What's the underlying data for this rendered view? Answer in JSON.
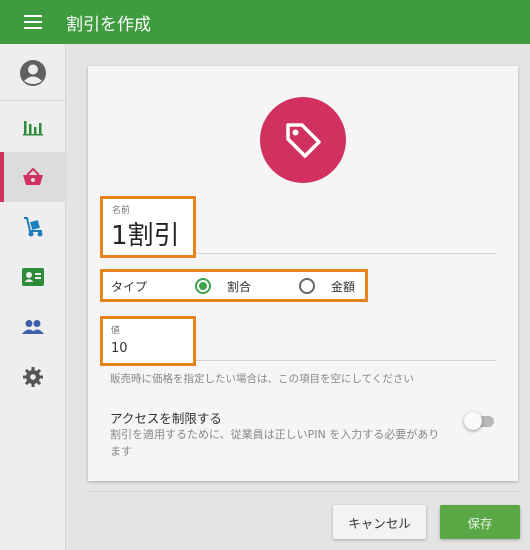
{
  "appbar": {
    "title": "割引を作成",
    "menu_icon": "hamburger-menu-icon"
  },
  "sidebar": {
    "items": [
      {
        "name": "account",
        "icon": "account-circle-icon",
        "color": "#616161"
      },
      {
        "name": "reports",
        "icon": "bar-chart-icon",
        "color": "#2e8b3a"
      },
      {
        "name": "discounts",
        "icon": "basket-icon",
        "color": "#d0315f",
        "active": true
      },
      {
        "name": "delivery",
        "icon": "hand-truck-icon",
        "color": "#1e7fc0"
      },
      {
        "name": "customers",
        "icon": "id-card-icon",
        "color": "#2e8b3a"
      },
      {
        "name": "employees",
        "icon": "people-icon",
        "color": "#3b5fa8"
      },
      {
        "name": "settings",
        "icon": "gear-icon",
        "color": "#555555"
      }
    ]
  },
  "form": {
    "tag_icon": "tag-icon",
    "tag_color": "#d0315f",
    "name_caption": "名前",
    "name_value": "1割引",
    "type_label": "タイプ",
    "type_options": [
      {
        "label": "割合",
        "selected": true
      },
      {
        "label": "金額",
        "selected": false
      }
    ],
    "value_caption": "値",
    "value_value": "10",
    "helper_text": "販売時に価格を指定したい場合は、この項目を空にしてください",
    "access_title": "アクセスを制限する",
    "access_desc": "割引を適用するために、従業員は正しいPIN を入力する必要があります",
    "access_enabled": false
  },
  "actions": {
    "cancel_label": "キャンセル",
    "save_label": "保存"
  },
  "colors": {
    "accent": "#3e9b3e",
    "highlight": "#e8821e",
    "save": "#5aa845"
  }
}
